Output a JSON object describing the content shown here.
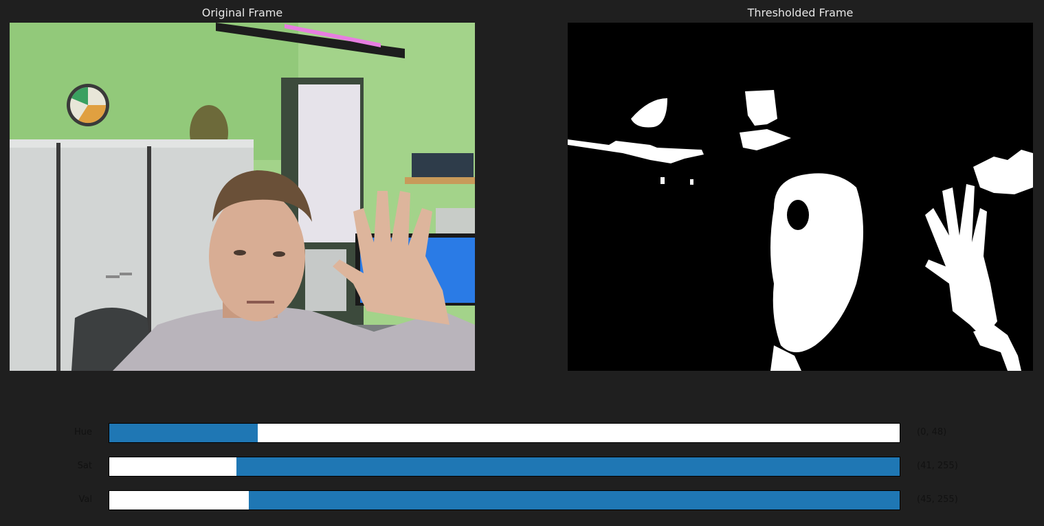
{
  "titles": {
    "original": "Original Frame",
    "thresholded": "Thresholded Frame"
  },
  "colors": {
    "background": "#1f1f1f",
    "slider_fill": "#1f77b4",
    "slider_track": "#ffffff",
    "wall_green": "#9fcf7f"
  },
  "sliders": [
    {
      "label": "Hue",
      "value_text": "(0, 48)",
      "min": 0,
      "max": 48,
      "range_max": 255
    },
    {
      "label": "Sat",
      "value_text": "(41, 255)",
      "min": 41,
      "max": 255,
      "range_max": 255
    },
    {
      "label": "Val",
      "value_text": "(45, 255)",
      "min": 45,
      "max": 255,
      "range_max": 255
    }
  ]
}
